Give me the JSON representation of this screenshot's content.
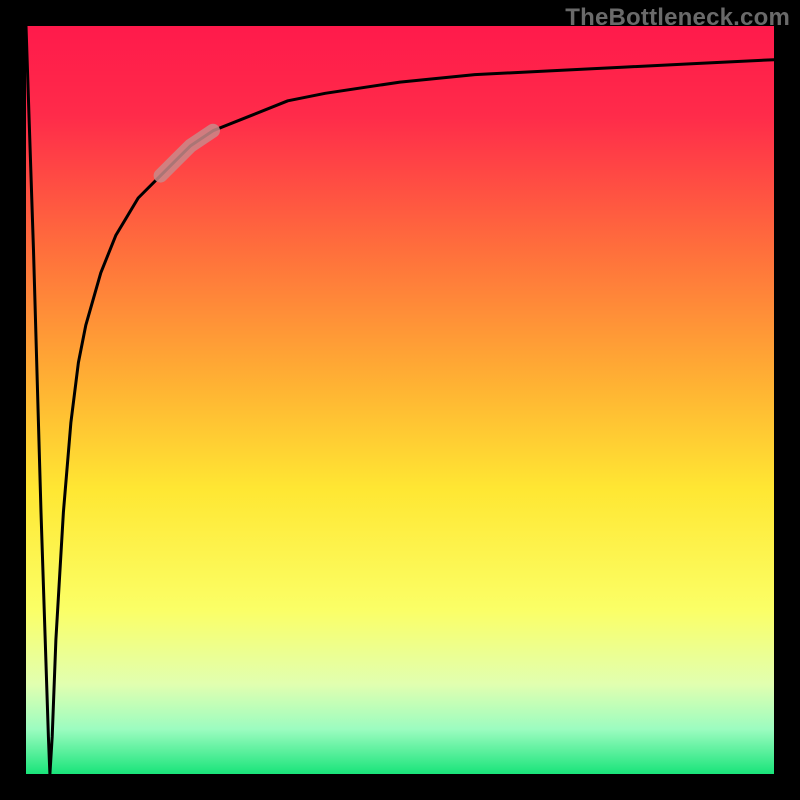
{
  "watermark": "TheBottleneck.com",
  "chart_data": {
    "type": "line",
    "title": "",
    "xlabel": "",
    "ylabel": "",
    "xlim": [
      0,
      100
    ],
    "ylim": [
      0,
      100
    ],
    "x": [
      0,
      1,
      2,
      3,
      3.2,
      3.5,
      4,
      5,
      6,
      7,
      8,
      10,
      12,
      15,
      18,
      20,
      22,
      25,
      30,
      35,
      40,
      50,
      60,
      70,
      80,
      90,
      100
    ],
    "values": [
      100,
      70,
      35,
      5,
      0,
      5,
      18,
      35,
      47,
      55,
      60,
      67,
      72,
      77,
      80,
      82,
      84,
      86,
      88,
      90,
      91,
      92.5,
      93.5,
      94,
      94.5,
      95,
      95.5
    ],
    "highlight_segment": {
      "x_start": 18,
      "x_end": 25
    },
    "gradient_stops": [
      {
        "offset": 0.0,
        "color": "#ff1a4b"
      },
      {
        "offset": 0.12,
        "color": "#ff2b4a"
      },
      {
        "offset": 0.3,
        "color": "#ff6f3c"
      },
      {
        "offset": 0.48,
        "color": "#ffb233"
      },
      {
        "offset": 0.62,
        "color": "#ffe733"
      },
      {
        "offset": 0.78,
        "color": "#fbff66"
      },
      {
        "offset": 0.88,
        "color": "#e1ffb0"
      },
      {
        "offset": 0.94,
        "color": "#9cfcc0"
      },
      {
        "offset": 1.0,
        "color": "#19e47a"
      }
    ]
  }
}
